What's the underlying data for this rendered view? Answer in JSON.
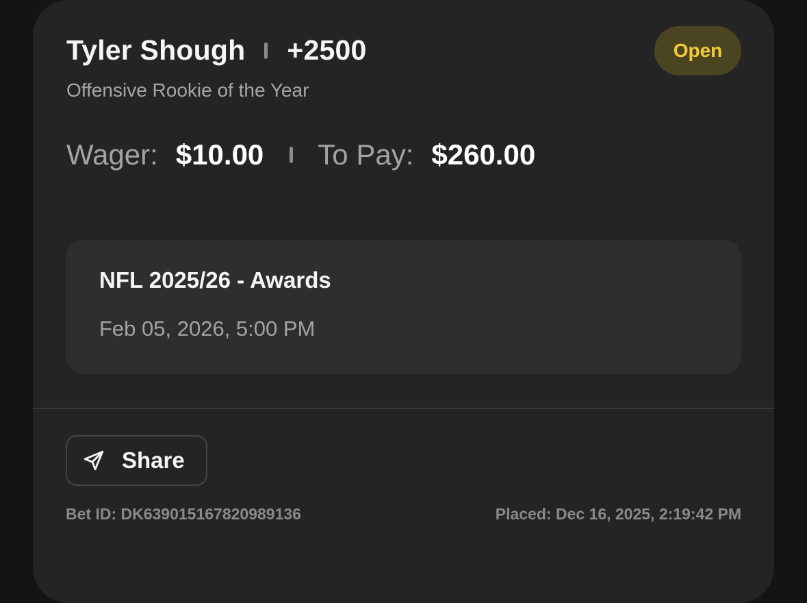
{
  "bet": {
    "selection": "Tyler Shough",
    "odds": "+2500",
    "market": "Offensive Rookie of the Year",
    "status": "Open"
  },
  "amounts": {
    "wager_label": "Wager:",
    "wager_value": "$10.00",
    "topay_label": "To Pay:",
    "topay_value": "$260.00"
  },
  "event": {
    "title": "NFL 2025/26 - Awards",
    "date": "Feb 05, 2026, 5:00 PM"
  },
  "actions": {
    "share_label": "Share",
    "share_icon": "paper-plane-icon"
  },
  "footer": {
    "bet_id": "Bet ID: DK639015167820989136",
    "placed": "Placed: Dec 16, 2025, 2:19:42 PM"
  },
  "colors": {
    "background": "#141414",
    "card": "#242424",
    "badge_bg": "#4a4420",
    "badge_text": "#f2cc3a",
    "muted_text": "#a3a3a3"
  }
}
